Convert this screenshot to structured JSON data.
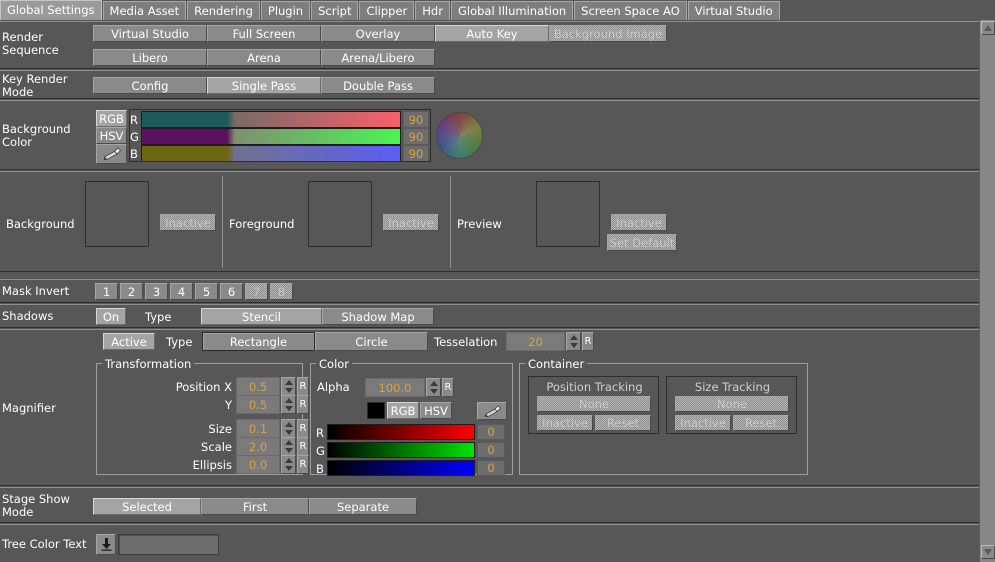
{
  "tabs": [
    {
      "label": "Global Settings",
      "selected": true
    },
    {
      "label": "Media Asset",
      "selected": false
    },
    {
      "label": "Rendering",
      "selected": false
    },
    {
      "label": "Plugin",
      "selected": false
    },
    {
      "label": "Script",
      "selected": false
    },
    {
      "label": "Clipper",
      "selected": false
    },
    {
      "label": "Hdr",
      "selected": false
    },
    {
      "label": "Global Illumination",
      "selected": false
    },
    {
      "label": "Screen Space AO",
      "selected": false
    },
    {
      "label": "Virtual Studio",
      "selected": false
    }
  ],
  "render_sequence": {
    "label": "Render\nSequence",
    "row1": [
      {
        "label": "Virtual Studio",
        "state": "normal"
      },
      {
        "label": "Full Screen",
        "state": "normal"
      },
      {
        "label": "Overlay",
        "state": "normal"
      },
      {
        "label": "Auto Key",
        "state": "selected"
      },
      {
        "label": "Background Image",
        "state": "disabled"
      }
    ],
    "row2": [
      {
        "label": "Libero",
        "state": "normal"
      },
      {
        "label": "Arena",
        "state": "normal"
      },
      {
        "label": "Arena/Libero",
        "state": "normal"
      }
    ]
  },
  "key_render_mode": {
    "label": "Key Render\nMode",
    "buttons": [
      {
        "label": "Config",
        "state": "normal"
      },
      {
        "label": "Single Pass",
        "state": "selected"
      },
      {
        "label": "Double Pass",
        "state": "normal"
      }
    ]
  },
  "background_color": {
    "label": "Background\nColor",
    "mode_buttons": [
      {
        "label": "RGB",
        "state": "selected"
      },
      {
        "label": "HSV",
        "state": "normal"
      }
    ],
    "picker_icon": "eyedropper-icon",
    "channels": [
      {
        "name": "R",
        "value": "90",
        "fill": "#1d5a5c",
        "mid": "#7a6a66",
        "end": "#f9606a"
      },
      {
        "name": "G",
        "value": "90",
        "fill": "#5c1060",
        "mid": "#7f8f70",
        "end": "#4cf454"
      },
      {
        "name": "B",
        "value": "90",
        "fill": "#6d6510",
        "mid": "#6f7190",
        "end": "#5a5ef4"
      }
    ],
    "wheel_icon": "color-wheel"
  },
  "preview_panels": [
    {
      "label": "Background",
      "buttons": [
        {
          "label": "Inactive",
          "state": "disabled"
        }
      ]
    },
    {
      "label": "Foreground",
      "buttons": [
        {
          "label": "Inactive",
          "state": "disabled"
        }
      ]
    },
    {
      "label": "Preview",
      "buttons": [
        {
          "label": "Inactive",
          "state": "disabled"
        },
        {
          "label": "Set Default",
          "state": "disabled"
        }
      ]
    }
  ],
  "mask_invert": {
    "label": "Mask Invert",
    "buttons": [
      {
        "label": "1",
        "state": "normal"
      },
      {
        "label": "2",
        "state": "normal"
      },
      {
        "label": "3",
        "state": "normal"
      },
      {
        "label": "4",
        "state": "normal"
      },
      {
        "label": "5",
        "state": "normal"
      },
      {
        "label": "6",
        "state": "normal"
      },
      {
        "label": "7",
        "state": "disabled"
      },
      {
        "label": "8",
        "state": "disabled"
      }
    ]
  },
  "shadows": {
    "label": "Shadows",
    "on_label": "On",
    "type_label": "Type",
    "types": [
      {
        "label": "Stencil",
        "state": "selected"
      },
      {
        "label": "Shadow Map",
        "state": "normal"
      }
    ]
  },
  "magnifier": {
    "label": "Magnifier",
    "active_label": "Active",
    "type_label": "Type",
    "shapes": [
      {
        "label": "Rectangle",
        "state": "framed"
      },
      {
        "label": "Circle",
        "state": "normal"
      }
    ],
    "tesselation_label": "Tesselation",
    "tesselation_value": "20",
    "reset_label": "R",
    "transformation": {
      "legend": "Transformation",
      "fields": [
        {
          "label": "Position X",
          "value": "0.5",
          "reset": "R"
        },
        {
          "label": "Y",
          "value": "0.5",
          "reset": "R"
        },
        {
          "label": "Size",
          "value": "0.1",
          "reset": "R"
        },
        {
          "label": "Scale",
          "value": "2.0",
          "reset": "R"
        },
        {
          "label": "Ellipsis",
          "value": "0.0",
          "reset": "R"
        }
      ]
    },
    "color": {
      "legend": "Color",
      "alpha_label": "Alpha",
      "alpha_value": "100.0",
      "alpha_reset": "R",
      "swatch_color": "#000000",
      "mode_buttons": [
        {
          "label": "RGB",
          "state": "selected"
        },
        {
          "label": "HSV",
          "state": "normal"
        }
      ],
      "picker_icon": "eyedropper-icon",
      "channels": [
        {
          "name": "R",
          "value": "0",
          "start": "#000000",
          "end": "#ff0000"
        },
        {
          "name": "G",
          "value": "0",
          "start": "#000000",
          "end": "#00e400"
        },
        {
          "name": "B",
          "value": "0",
          "start": "#000000",
          "end": "#0000ff"
        }
      ]
    },
    "container": {
      "legend": "Container",
      "groups": [
        {
          "title": "Position Tracking",
          "none_label": "None",
          "buttons": [
            {
              "label": "Inactive",
              "state": "disabled"
            },
            {
              "label": "Reset",
              "state": "disabled"
            }
          ]
        },
        {
          "title": "Size Tracking",
          "none_label": "None",
          "buttons": [
            {
              "label": "Inactive",
              "state": "disabled"
            },
            {
              "label": "Reset",
              "state": "disabled"
            }
          ]
        }
      ]
    }
  },
  "stage_show_mode": {
    "label": "Stage Show\nMode",
    "buttons": [
      {
        "label": "Selected",
        "state": "selected"
      },
      {
        "label": "First",
        "state": "normal"
      },
      {
        "label": "Separate",
        "state": "normal"
      }
    ]
  },
  "tree_color_text": {
    "label": "Tree Color Text",
    "button_icon": "download-arrow-icon",
    "value": "",
    "placeholder": ""
  },
  "scrollbar": {
    "up_icon": "scroll-up-arrow-icon",
    "down_icon": "scroll-down-arrow-icon"
  },
  "colors": {
    "background": "#575757",
    "button": "#8a8a8a",
    "button_selected": "#a4a4a4",
    "text": "#ffffff",
    "value_text": "#d9a441",
    "separator_light": "#8f8f8f",
    "separator_dark": "#2e2e2e"
  }
}
